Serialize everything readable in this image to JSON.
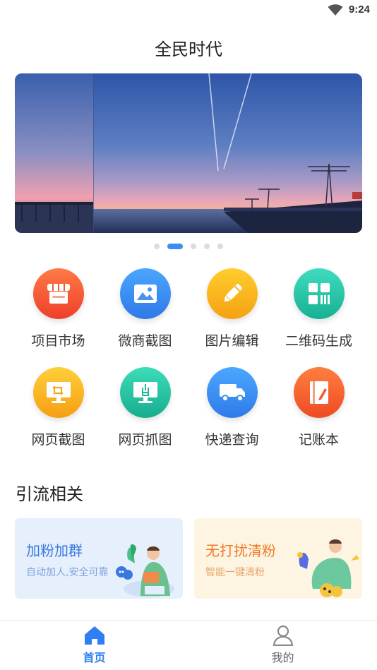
{
  "status_bar": {
    "time": "9:24"
  },
  "header": {
    "title": "全民时代"
  },
  "banner": {
    "slides_count": 5,
    "active_index": 1
  },
  "tools": [
    {
      "label": "项目市场",
      "icon": "store-icon",
      "color": "#f4572d"
    },
    {
      "label": "微商截图",
      "icon": "image-icon",
      "color": "#3a8ef0"
    },
    {
      "label": "图片编辑",
      "icon": "pencil-icon",
      "color": "#f6b218"
    },
    {
      "label": "二维码生成",
      "icon": "qrcode-icon",
      "color": "#22c4a4"
    },
    {
      "label": "网页截图",
      "icon": "crop-screen-icon",
      "color": "#f7b31d"
    },
    {
      "label": "网页抓图",
      "icon": "grab-screen-icon",
      "color": "#25c2a0"
    },
    {
      "label": "快递查询",
      "icon": "truck-icon",
      "color": "#3a8ef0"
    },
    {
      "label": "记账本",
      "icon": "notebook-icon",
      "color": "#f4602a"
    }
  ],
  "section": {
    "title": "引流相关"
  },
  "cards": [
    {
      "title": "加粉加群",
      "subtitle": "自动加人,安全可靠"
    },
    {
      "title": "无打扰清粉",
      "subtitle": "智能一键清粉"
    }
  ],
  "bottom_nav": [
    {
      "label": "首页",
      "icon": "home-icon",
      "active": true
    },
    {
      "label": "我的",
      "icon": "user-icon",
      "active": false
    }
  ]
}
